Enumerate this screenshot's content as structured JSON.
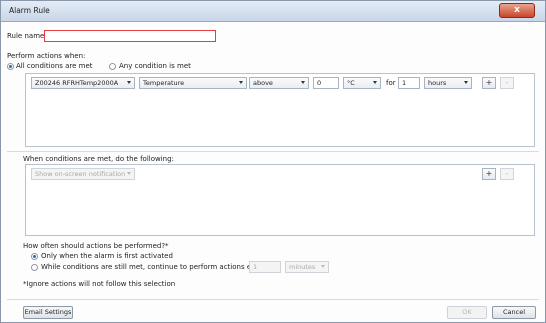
{
  "window": {
    "title": "Alarm Rule",
    "close_glyph": "x"
  },
  "rule_name": {
    "label": "Rule name:",
    "value": ""
  },
  "conditions": {
    "heading": "Perform actions when:",
    "mode_all": "All conditions are met",
    "mode_any": "Any condition is met",
    "row": {
      "device": "Z00246 RFRHTemp2000A",
      "sensor": "Temperature",
      "comparator": "above",
      "value": "0",
      "unit": "°C",
      "for_label": "for",
      "duration": "1",
      "duration_unit": "hours",
      "add": "+",
      "remove": "-"
    }
  },
  "actions": {
    "heading": "When conditions are met, do the following:",
    "action": "Show on-screen notification",
    "add": "+",
    "remove": "-"
  },
  "frequency": {
    "heading": "How often should actions be performed?*",
    "option_first": "Only when the alarm is first activated",
    "option_repeat": "While conditions are still met, continue to perform actions every:",
    "interval": "1",
    "interval_unit": "minutes",
    "footnote": "*Ignore actions will not follow this selection"
  },
  "footer": {
    "email": "Email Settings",
    "ok": "OK",
    "cancel": "Cancel"
  }
}
